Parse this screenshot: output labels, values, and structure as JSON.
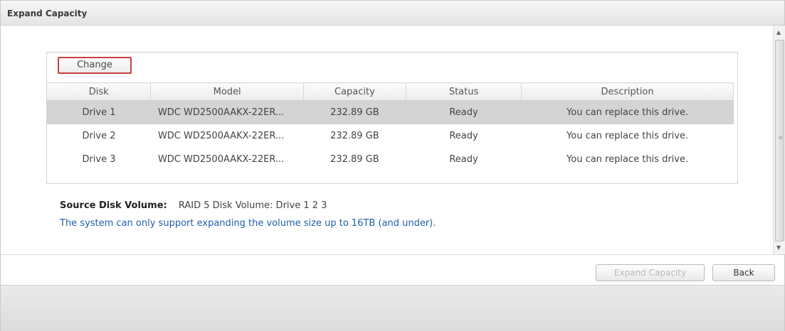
{
  "window": {
    "title": "Expand Capacity"
  },
  "toolbar": {
    "change_label": "Change"
  },
  "table": {
    "columns": [
      "Disk",
      "Model",
      "Capacity",
      "Status",
      "Description"
    ],
    "rows": [
      {
        "disk": "Drive 1",
        "model": "WDC WD2500AAKX-22ER...",
        "capacity": "232.89 GB",
        "status": "Ready",
        "description": "You can replace this drive.",
        "selected": true
      },
      {
        "disk": "Drive 2",
        "model": "WDC WD2500AAKX-22ER...",
        "capacity": "232.89 GB",
        "status": "Ready",
        "description": "You can replace this drive.",
        "selected": false
      },
      {
        "disk": "Drive 3",
        "model": "WDC WD2500AAKX-22ER...",
        "capacity": "232.89 GB",
        "status": "Ready",
        "description": "You can replace this drive.",
        "selected": false
      }
    ]
  },
  "source": {
    "label": "Source Disk Volume:",
    "value": "RAID 5 Disk Volume: Drive 1 2 3"
  },
  "note": "The system can only support expanding the volume size up to 16TB (and under).",
  "footer": {
    "expand_label": "Expand Capacity",
    "back_label": "Back"
  },
  "colors": {
    "note_text": "#1f5fa8",
    "change_highlight": "#c94040",
    "selected_row": "#d4d4d4"
  }
}
